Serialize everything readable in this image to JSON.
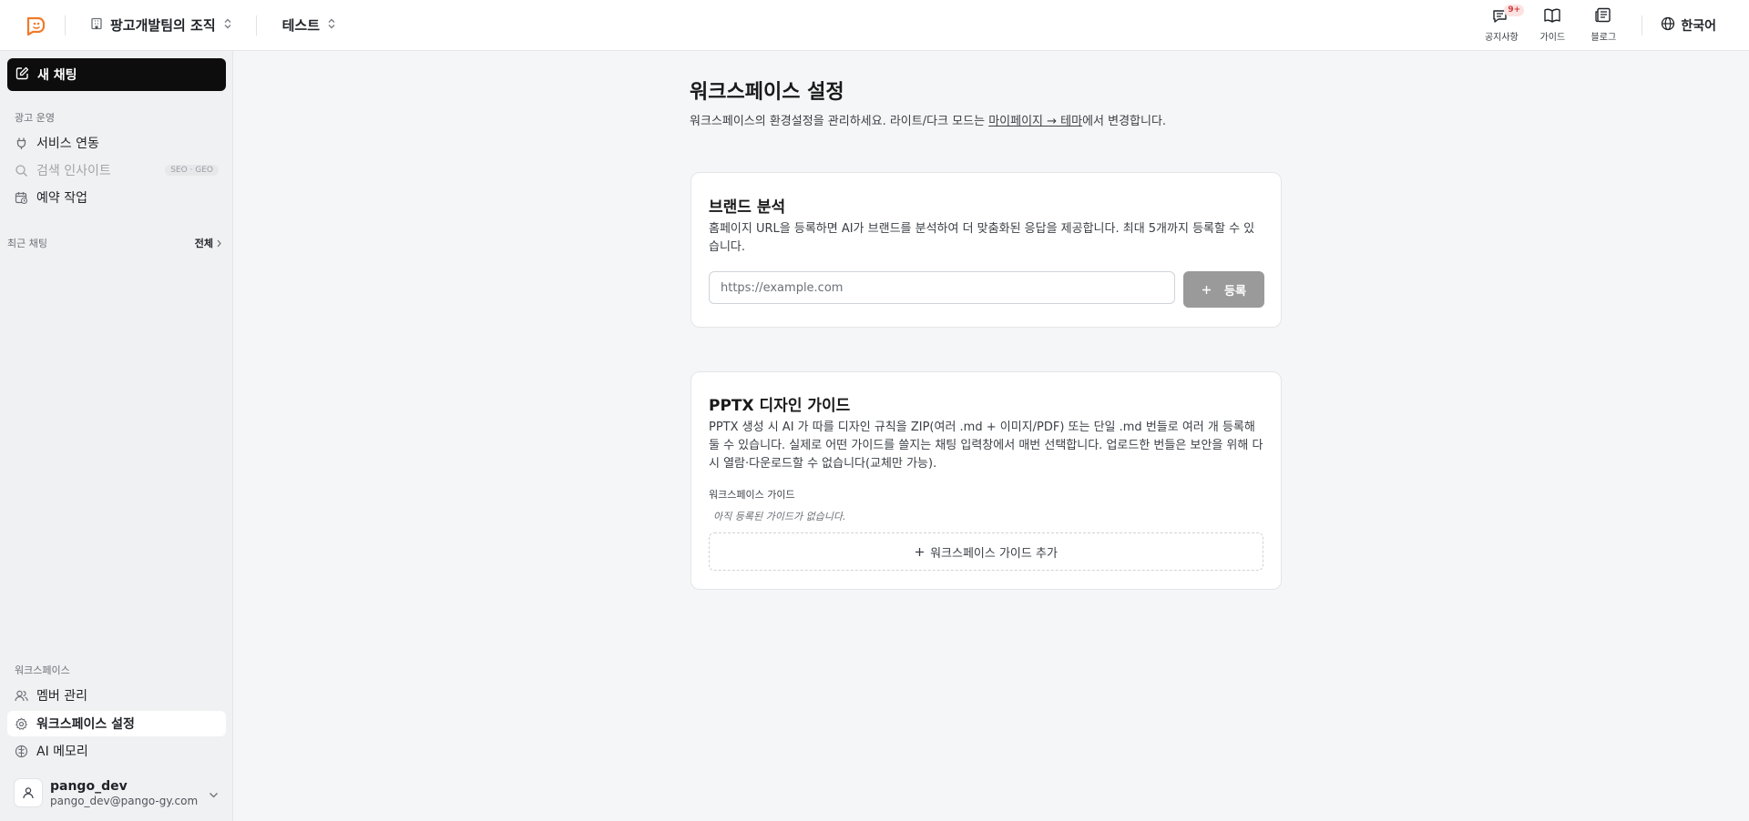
{
  "header": {
    "org_name": "팡고개발팀의 조직",
    "project_name": "테스트",
    "notice_label": "공지사항",
    "notice_badge": "9+",
    "guide_label": "가이드",
    "blog_label": "블로그",
    "language": "한국어"
  },
  "sidebar": {
    "new_chat": "새 채팅",
    "ads_section": "광고 운영",
    "items": [
      {
        "label": "서비스 연동",
        "icon": "plug-icon"
      },
      {
        "label": "검색 인사이트",
        "icon": "search-icon",
        "pill": "SEO · GEO",
        "disabled": true
      },
      {
        "label": "예약 작업",
        "icon": "calendar-clock-icon"
      }
    ],
    "recent_label": "최근 채팅",
    "recent_all": "전체",
    "workspace_section": "워크스페이스",
    "workspace_items": [
      {
        "label": "멤버 관리",
        "icon": "users-icon"
      },
      {
        "label": "워크스페이스 설정",
        "icon": "gear-icon",
        "active": true
      },
      {
        "label": "AI 메모리",
        "icon": "brain-icon"
      }
    ],
    "user": {
      "name": "pango_dev",
      "email": "pango_dev@pango-gy.com"
    }
  },
  "main": {
    "title": "워크스페이스 설정",
    "desc_before": "워크스페이스의 환경설정을 관리하세요. 라이트/다크 모드는 ",
    "desc_link": "마이페이지 → 테마",
    "desc_after": "에서 변경합니다.",
    "brand": {
      "title": "브랜드 분석",
      "desc": "홈페이지 URL을 등록하면 AI가 브랜드를 분석하여 더 맞춤화된 응답을 제공합니다. 최대 5개까지 등록할 수 있습니다.",
      "input_placeholder": "https://example.com",
      "input_value": "",
      "register_label": "등록"
    },
    "pptx": {
      "title": "PPTX 디자인 가이드",
      "desc": "PPTX 생성 시 AI 가 따를 디자인 규칙을 ZIP(여러 .md + 이미지/PDF) 또는 단일 .md 번들로 여러 개 등록해 둘 수 있습니다. 실제로 어떤 가이드를 쓸지는 채팅 입력창에서 매번 선택합니다. 업로드한 번들은 보안을 위해 다시 열람·다운로드할 수 없습니다(교체만 가능).",
      "section_label": "워크스페이스 가이드",
      "empty_note": "아직 등록된 가이드가 없습니다.",
      "add_label": "워크스페이스 가이드 추가"
    }
  }
}
